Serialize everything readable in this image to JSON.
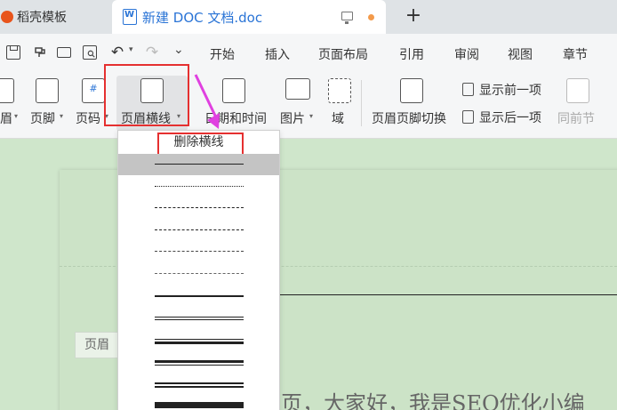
{
  "tabs": [
    {
      "label": "稻壳模板"
    },
    {
      "label": "新建 DOC 文档.doc"
    }
  ],
  "menu": [
    "开始",
    "插入",
    "页面布局",
    "引用",
    "审阅",
    "视图",
    "章节"
  ],
  "ribbon": {
    "partial_left": "眉",
    "footer": "页脚",
    "page_num": "页码",
    "header_line": "页眉横线",
    "date_time": "日期和时间",
    "picture": "图片",
    "field": "域",
    "switch": "页眉页脚切换",
    "show_prev": "显示前一项",
    "show_next": "显示后一项",
    "same_prev": "同前节"
  },
  "dropdown": {
    "delete_label": "删除横线",
    "line_styles": [
      "solid",
      "dotted",
      "dashed",
      "dashed",
      "dash-dot",
      "dash-dot-dot",
      "thick",
      "double",
      "thin-thick",
      "thick-thin",
      "thick-thick",
      "triple"
    ],
    "selected_index": 0
  },
  "document": {
    "header_tag": "页眉",
    "body_text": "页，大家好，我是SEO优化小编"
  },
  "colors": {
    "accent": "#2a74d6",
    "highlight_box": "#e53030",
    "arrow": "#e040e0",
    "doc_bg": "#cce3c7"
  }
}
